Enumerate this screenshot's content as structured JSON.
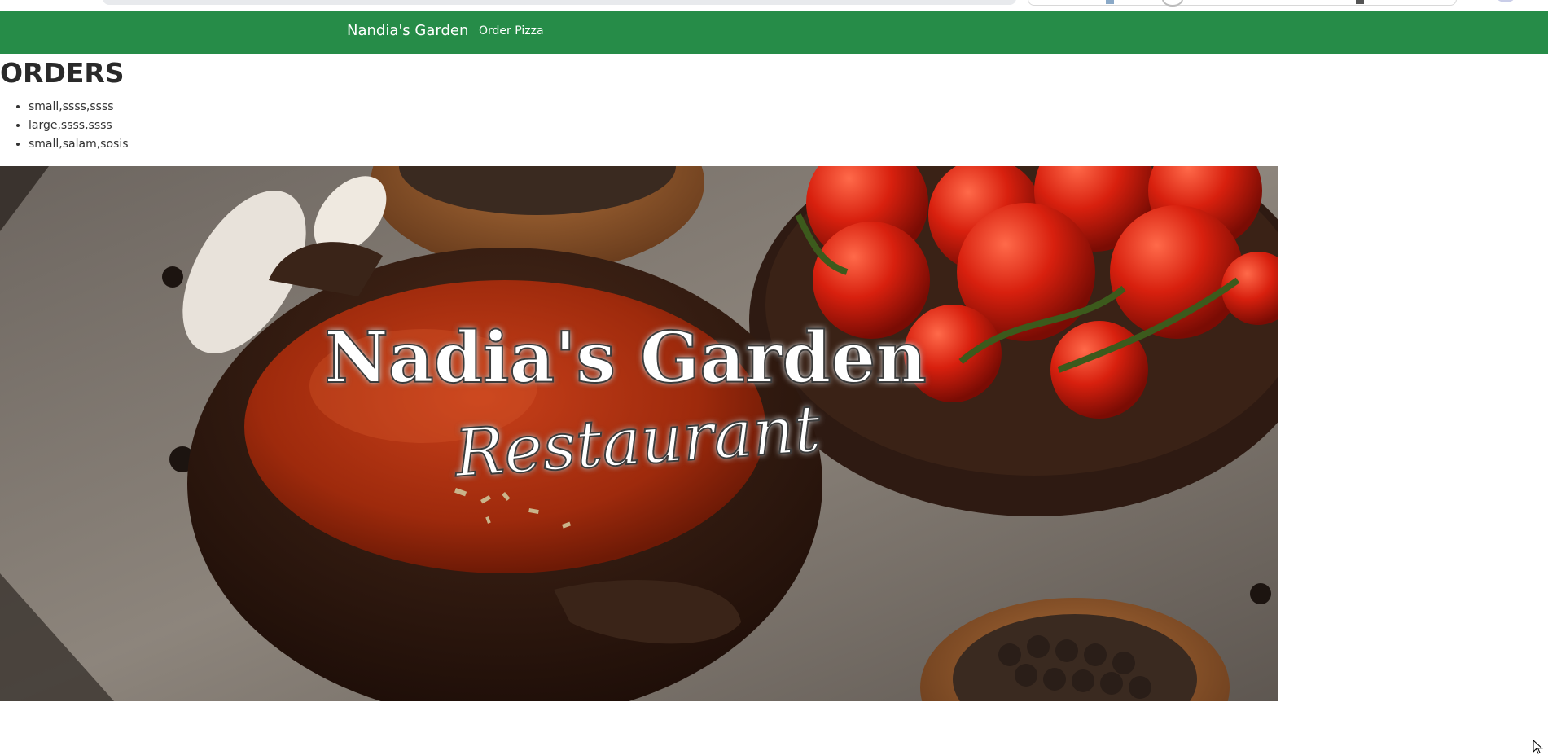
{
  "navbar": {
    "brand": "Nandia's Garden",
    "links": [
      "Order Pizza"
    ],
    "color": "#268c48"
  },
  "orders": {
    "title": "ORDERS",
    "items": [
      "small,ssss,ssss",
      "large,ssss,ssss",
      "small,salam,sosis"
    ]
  },
  "hero": {
    "title_line1": "Nadia's Garden",
    "title_line2": "Restaurant"
  }
}
